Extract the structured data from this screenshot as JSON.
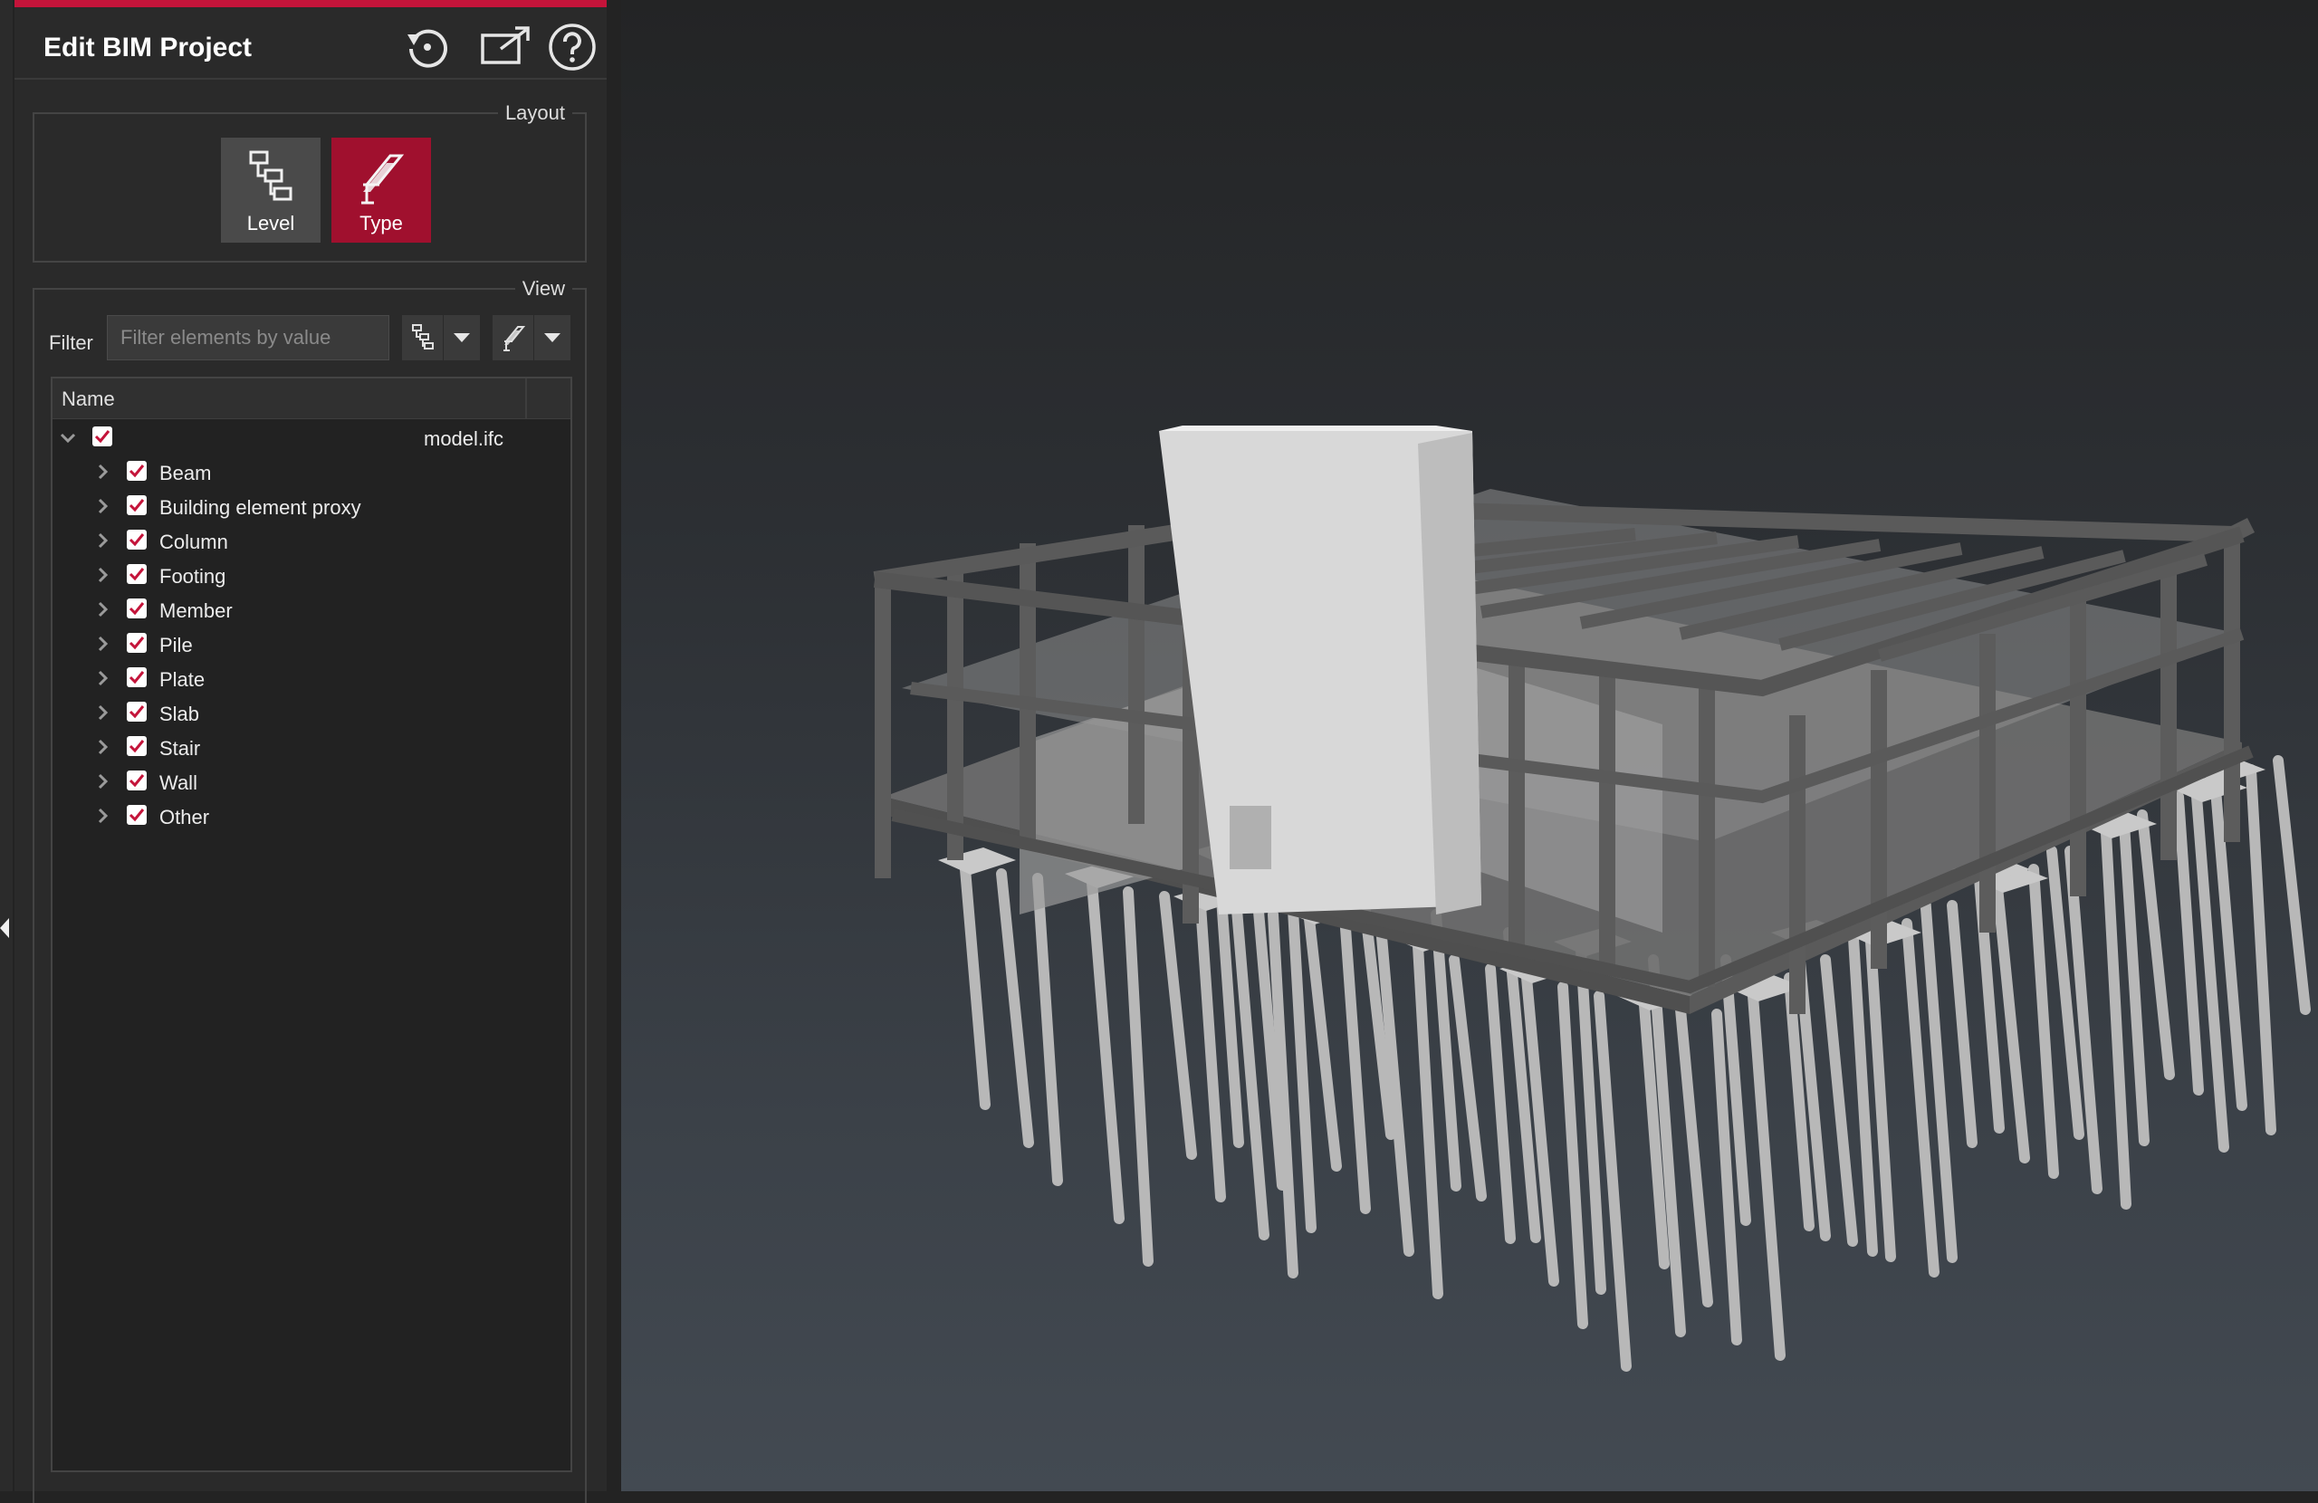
{
  "panel": {
    "title": "Edit BIM Project",
    "header_icons": [
      "history-icon",
      "export-icon",
      "help-icon"
    ]
  },
  "layout": {
    "label": "Layout",
    "buttons": [
      {
        "label": "Level",
        "icon": "hierarchy-icon",
        "active": false
      },
      {
        "label": "Type",
        "icon": "steel-beam-icon",
        "active": true
      }
    ]
  },
  "view": {
    "label": "View",
    "filter_label": "Filter",
    "filter_value": "",
    "filter_placeholder": "Filter elements by value"
  },
  "tree": {
    "column_name": "Name",
    "root": {
      "label": "model.ifc",
      "checked": true,
      "expanded": true
    },
    "items": [
      {
        "label": "Beam",
        "checked": true
      },
      {
        "label": "Building element proxy",
        "checked": true
      },
      {
        "label": "Column",
        "checked": true
      },
      {
        "label": "Footing",
        "checked": true
      },
      {
        "label": "Member",
        "checked": true
      },
      {
        "label": "Pile",
        "checked": true
      },
      {
        "label": "Plate",
        "checked": true
      },
      {
        "label": "Slab",
        "checked": true
      },
      {
        "label": "Stair",
        "checked": true
      },
      {
        "label": "Wall",
        "checked": true
      },
      {
        "label": "Other",
        "checked": true
      }
    ]
  },
  "colors": {
    "accent": "#c4143a",
    "active_button": "#a0102e",
    "panel_bg": "#2a2a2a",
    "checkbox_check": "#c4143a"
  }
}
